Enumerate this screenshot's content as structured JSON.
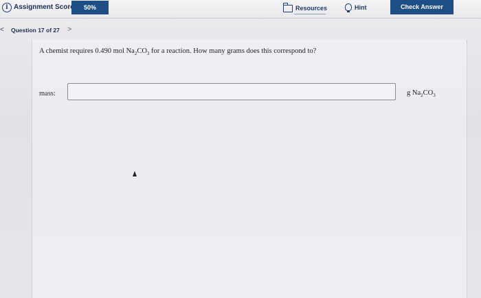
{
  "topbar": {
    "score_label": "Assignment Score:",
    "score_value": "50%",
    "resources_label": "Resources",
    "hint_label": "Hint",
    "check_answer_label": "Check Answer"
  },
  "question_nav": {
    "label": "Question 17 of 27",
    "next_glyph": ">",
    "prev_glyph": "<"
  },
  "question": {
    "prefix": "A chemist requires 0.490 mol Na",
    "sub1": "2",
    "mid": "CO",
    "sub2": "3",
    "suffix": " for a reaction. How many grams does this correspond to?"
  },
  "answer": {
    "label": "mass:",
    "value": "",
    "placeholder": "",
    "unit_prefix": "g Na",
    "unit_sub1": "2",
    "unit_mid": "CO",
    "unit_sub2": "3"
  },
  "colors": {
    "accent": "#1d4f86",
    "text_dark": "#1a2f55"
  },
  "icons": {
    "score": "info-circle-icon",
    "resources": "folder-icon",
    "hint": "lightbulb-icon"
  }
}
